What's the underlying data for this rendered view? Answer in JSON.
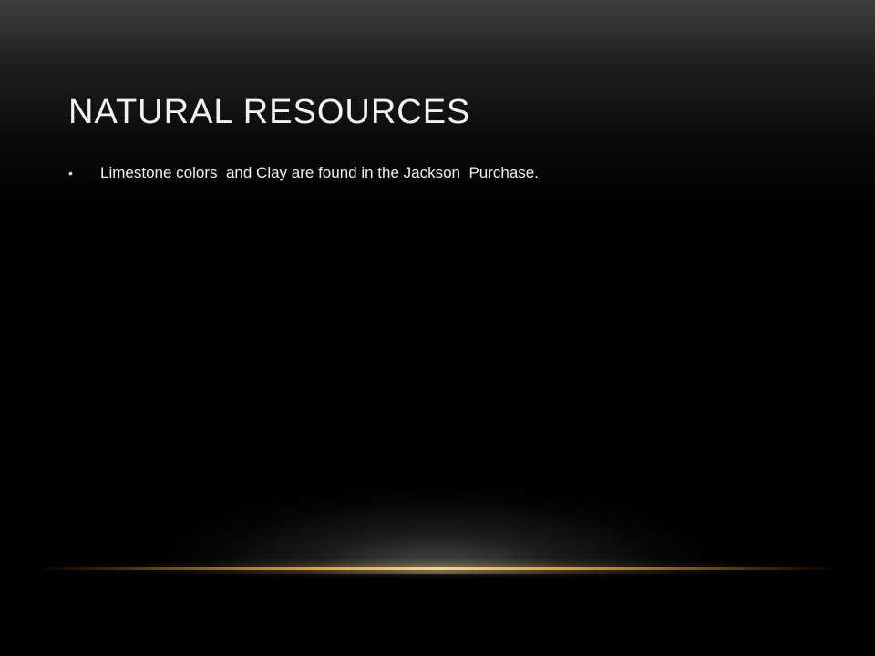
{
  "slide": {
    "title": "NATURAL RESOURCES",
    "bullets": [
      "Limestone colors  and Clay are found in the Jackson  Purchase."
    ],
    "bullet_glyph": "•"
  },
  "colors": {
    "background": "#000000",
    "title_text": "#f2f2f2",
    "body_text": "#f0f0f0",
    "accent_gold": "#d9a44a"
  }
}
